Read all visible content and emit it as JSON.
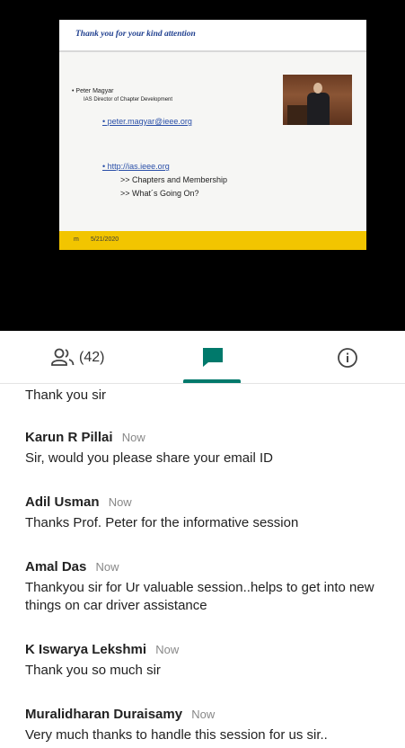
{
  "presentation": {
    "slide_title": "Thank you for your kind attention",
    "presenter_name": "• Peter Magyar",
    "presenter_role": "IAS Director of Chapter Development",
    "email_link": "• peter.magyar@ieee.org",
    "site_link": "• http://ias.ieee.org",
    "site_item_1": ">> Chapters and Membership",
    "site_item_2": ">> What´s Going On?",
    "footer_mark": "m",
    "footer_date": "5/21/2020"
  },
  "tabs": {
    "people_count": "(42)",
    "active_color": "#00796b"
  },
  "messages": [
    {
      "text": "Thank you sir"
    },
    {
      "name": "Karun R Pillai",
      "time": "Now",
      "text": "Sir, would you please share your email ID"
    },
    {
      "name": "Adil Usman",
      "time": "Now",
      "text": "Thanks Prof. Peter for the informative session"
    },
    {
      "name": "Amal Das",
      "time": "Now",
      "text": "Thankyou sir for Ur valuable session..helps to get into new things on car driver assistance"
    },
    {
      "name": "K Iswarya Lekshmi",
      "time": "Now",
      "text": "Thank you so much sir"
    },
    {
      "name": "Muralidharan Duraisamy",
      "time": "Now",
      "text": "Very much thanks to handle this session for us sir.."
    }
  ]
}
